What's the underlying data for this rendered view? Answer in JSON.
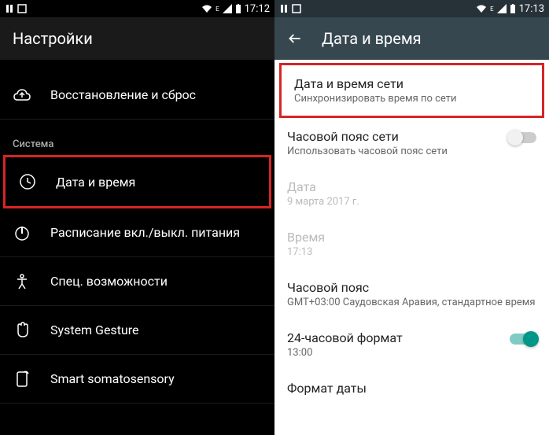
{
  "left": {
    "status": {
      "time": "17:12",
      "network_label": "E"
    },
    "app_bar_title": "Настройки",
    "items": [
      {
        "label": "Восстановление и сброс"
      }
    ],
    "section_header": "Система",
    "system_items": [
      {
        "label": "Дата и время"
      },
      {
        "label": "Расписание вкл./выкл. питания"
      },
      {
        "label": "Спец. возможности"
      },
      {
        "label": "System Gesture"
      },
      {
        "label": "Smart somatosensory"
      }
    ]
  },
  "right": {
    "status": {
      "time": "17:13",
      "network_label": "E"
    },
    "app_bar_title": "Дата и время",
    "items": [
      {
        "title": "Дата и время сети",
        "subtitle": "Синхронизировать время по сети"
      },
      {
        "title": "Часовой пояс сети",
        "subtitle": "Использовать часовой пояс сети"
      },
      {
        "title": "Дата",
        "subtitle": "9 марта 2017 г."
      },
      {
        "title": "Время",
        "subtitle": "17:13"
      },
      {
        "title": "Часовой пояс",
        "subtitle": "GMT+03:00 Саудовская Аравия, стандартное время"
      },
      {
        "title": "24-часовой формат",
        "subtitle": "13:00"
      },
      {
        "title": "Формат даты",
        "subtitle": ""
      }
    ]
  }
}
